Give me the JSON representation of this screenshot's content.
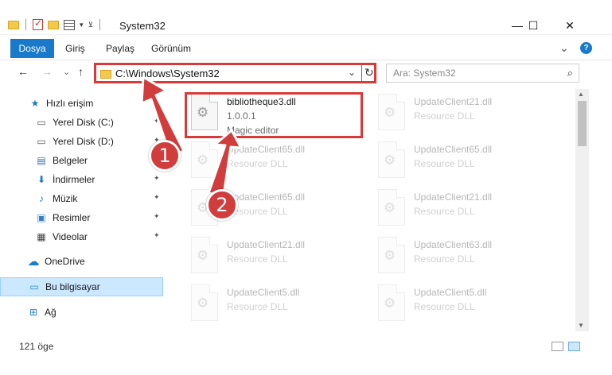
{
  "window": {
    "title": "System32",
    "minimize_glyph": "—",
    "maximize_glyph": "☐",
    "close_glyph": "✕"
  },
  "ribbon": {
    "tabs": [
      "Dosya",
      "Giriş",
      "Paylaş",
      "Görünüm"
    ],
    "expand_glyph": "⌄",
    "help_glyph": "?"
  },
  "navigation": {
    "back_glyph": "←",
    "forward_glyph": "→",
    "recent_glyph": "⌄",
    "up_glyph": "↑",
    "address_path": "C:\\Windows\\System32",
    "address_chevron": "⌄",
    "refresh_glyph": "↻",
    "search_placeholder": "Ara: System32",
    "search_glyph": "⌕"
  },
  "sidebar": {
    "items": [
      {
        "label": "Hızlı erişim",
        "icon": "star-icon",
        "glyph": "★",
        "color": "#1979ca",
        "pinned": false
      },
      {
        "label": "Yerel Disk (C:)",
        "icon": "drive-icon",
        "glyph": "▭",
        "color": "#555555",
        "pinned": true
      },
      {
        "label": "Yerel Disk (D:)",
        "icon": "drive-icon",
        "glyph": "▭",
        "color": "#555555",
        "pinned": true
      },
      {
        "label": "Belgeler",
        "icon": "documents-icon",
        "glyph": "▤",
        "color": "#3a6fb0",
        "pinned": true
      },
      {
        "label": "İndirmeler",
        "icon": "download-icon",
        "glyph": "⬇",
        "color": "#1979ca",
        "pinned": true
      },
      {
        "label": "Müzik",
        "icon": "music-icon",
        "glyph": "♪",
        "color": "#1979ca",
        "pinned": true
      },
      {
        "label": "Resimler",
        "icon": "pictures-icon",
        "glyph": "▣",
        "color": "#3a7fbf",
        "pinned": true
      },
      {
        "label": "Videolar",
        "icon": "videos-icon",
        "glyph": "▦",
        "color": "#444444",
        "pinned": true
      },
      {
        "label": "OneDrive",
        "icon": "cloud-icon",
        "glyph": "☁",
        "color": "#1979ca",
        "pinned": false
      },
      {
        "label": "Bu bilgisayar",
        "icon": "computer-icon",
        "glyph": "▭",
        "color": "#2a7fd0",
        "pinned": false
      },
      {
        "label": "Ağ",
        "icon": "network-icon",
        "glyph": "⊞",
        "color": "#2a7fd0",
        "pinned": false
      }
    ],
    "pin_glyph": "📌"
  },
  "files": [
    {
      "name": "bibliotheque3.dll",
      "version": "1.0.0.1",
      "description": "Magic editor",
      "highlighted": true
    },
    {
      "name": "UpdateClient21.dll",
      "description": "Resource DLL"
    },
    {
      "name": "UpdateClient65.dll",
      "description": "Resource DLL"
    },
    {
      "name": "UpdateClient65.dll",
      "description": "Resource DLL"
    },
    {
      "name": "UpdateClient65.dll",
      "description": "Resource DLL"
    },
    {
      "name": "UpdateClient21.dll",
      "description": "Resource DLL"
    },
    {
      "name": "UpdateClient21.dll",
      "description": "Resource DLL"
    },
    {
      "name": "UpdateClient63.dll",
      "description": "Resource DLL"
    },
    {
      "name": "UpdateClient5.dll",
      "description": "Resource DLL"
    },
    {
      "name": "UpdateClient5.dll",
      "description": "Resource DLL"
    }
  ],
  "status": {
    "item_count": "121 öge"
  },
  "annotations": {
    "badge_1": "1",
    "badge_2": "2",
    "accent_color": "#d13c3c"
  }
}
